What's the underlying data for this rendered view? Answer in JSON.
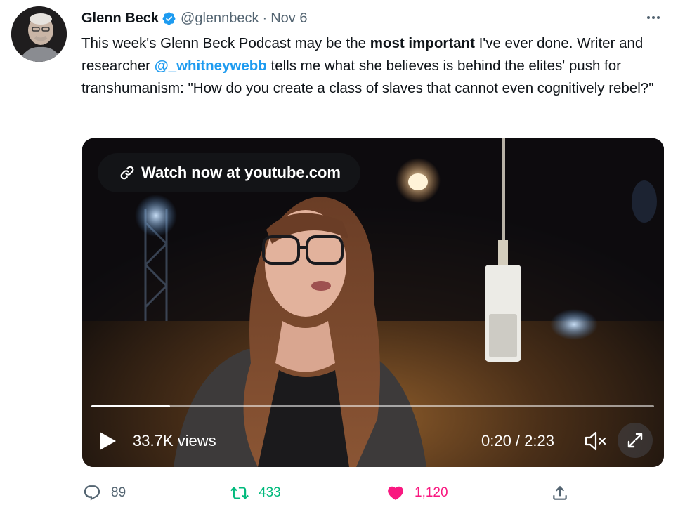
{
  "author": {
    "name": "Glenn Beck",
    "handle": "@glennbeck",
    "separator": "·",
    "date": "Nov 6"
  },
  "tweet": {
    "text_1": "This week's Glenn Beck Podcast may be the ",
    "bold": "most important",
    "text_2": " I've ever done. Writer and researcher ",
    "mention": "@_whitneywebb",
    "text_3": " tells me what she believes is behind the elites' push for transhumanism: \"How do you create a class of slaves that cannot even cognitively rebel?\""
  },
  "video": {
    "watch_label": "Watch now at youtube.com",
    "views": "33.7K views",
    "time": "0:20 / 2:23",
    "progress": 0.14
  },
  "actions": {
    "replies": "89",
    "retweets": "433",
    "likes": "1,120"
  },
  "colors": {
    "link": "#1d9bf0",
    "retweet": "#00ba7c",
    "like": "#f91880",
    "muted": "#536471"
  },
  "icons": [
    "verified-badge-icon",
    "more-icon",
    "link-icon",
    "play-icon",
    "volume-muted-icon",
    "expand-icon",
    "reply-icon",
    "retweet-icon",
    "like-icon",
    "share-icon"
  ]
}
